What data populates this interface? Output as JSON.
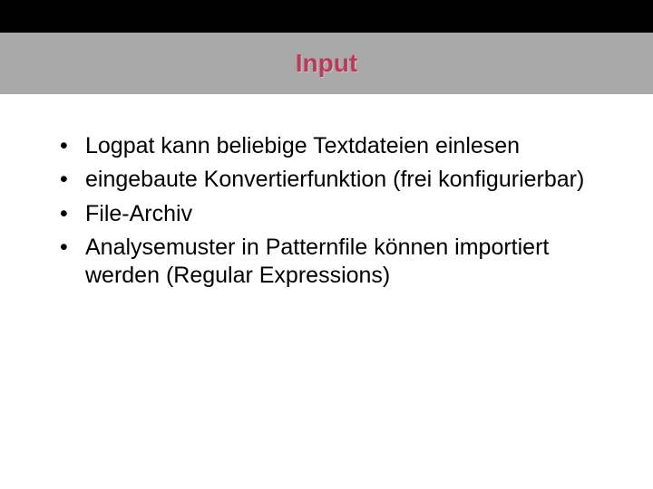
{
  "title": "Input",
  "bullets": [
    "Logpat kann beliebige Textdateien einlesen",
    "eingebaute Konvertierfunktion (frei konfigurierbar)",
    "File-Archiv",
    "Analysemuster in Patternfile können importiert werden (Regular Expressions)"
  ],
  "colors": {
    "title": "#b93a5b",
    "titlebar_bg": "#a9a9a9",
    "topbar_bg": "#000000"
  }
}
